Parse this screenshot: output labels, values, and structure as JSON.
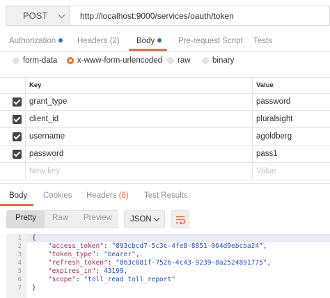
{
  "request": {
    "method": "POST",
    "url": "http://localhost:9000/services/oauth/token"
  },
  "request_tabs": [
    {
      "label": "Authorization",
      "dot_color": "#2a6fd6"
    },
    {
      "label": "Headers (2)"
    },
    {
      "label": "Body",
      "dot_color": "#2a6fd6",
      "active": true
    },
    {
      "label": "Pre-request Script"
    },
    {
      "label": "Tests"
    }
  ],
  "body_types": [
    {
      "label": "form-data",
      "selected": false
    },
    {
      "label": "x-www-form-urlencoded",
      "selected": true
    },
    {
      "label": "raw",
      "selected": false
    },
    {
      "label": "binary",
      "selected": false
    }
  ],
  "params_table": {
    "headers": {
      "key": "Key",
      "value": "Value"
    },
    "rows": [
      {
        "key": "grant_type",
        "value": "password",
        "checked": true
      },
      {
        "key": "client_id",
        "value": "pluralsight",
        "checked": true
      },
      {
        "key": "username",
        "value": "agoldberg",
        "checked": true
      },
      {
        "key": "password",
        "value": "pass1",
        "checked": true
      }
    ],
    "new_key_placeholder": "New key",
    "value_placeholder": "Value"
  },
  "response_tabs": [
    {
      "label": "Body",
      "active": true
    },
    {
      "label": "Cookies"
    },
    {
      "label": "Headers",
      "count": "(8)"
    },
    {
      "label": "Test Results"
    }
  ],
  "view_modes": [
    "Pretty",
    "Raw",
    "Preview"
  ],
  "format": "JSON",
  "response_body": {
    "line_numbers": [
      "1",
      "2",
      "3",
      "4",
      "5",
      "6",
      "7"
    ],
    "open": "{",
    "close": "}",
    "fields": [
      {
        "key": "\"access_token\"",
        "value": "\"893cbcd7-5c3c-4fe8-8851-064d9ebcba24\","
      },
      {
        "key": "\"token_type\"",
        "value": "\"bearer\","
      },
      {
        "key": "\"refresh_token\"",
        "value": "\"863c081f-7526-4c43-9239-8a2524891775\","
      },
      {
        "key": "\"expires_in\"",
        "value": "43199,"
      },
      {
        "key": "\"scope\"",
        "value": "\"toll_read toll_report\""
      }
    ]
  },
  "colors": {
    "accent": "#f26b3a",
    "dot_blue": "#2a6fd6",
    "json_key": "#a52c56",
    "json_value": "#2a4fbd"
  }
}
